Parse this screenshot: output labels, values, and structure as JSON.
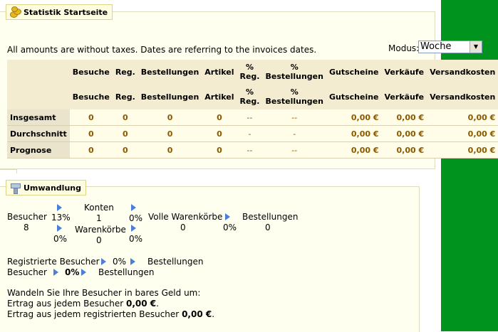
{
  "stats_panel": {
    "title": "Statistik Startseite",
    "icon": "coins-icon",
    "note": "All amounts are without taxes. Dates are referring to the invoices dates.",
    "mode_label": "Modus:",
    "mode_value": "Woche",
    "columns": [
      "Besuche",
      "Reg.",
      "Bestellungen",
      "Artikel",
      "% Reg.",
      "% Bestellungen",
      "Gutscheine",
      "Verkäufe",
      "Versandkosten"
    ],
    "rows": [
      {
        "label": "Insgesamt",
        "values": [
          "0",
          "0",
          "0",
          "0",
          "--",
          "--",
          "0,00 €",
          "0,00 €",
          "0,00 €"
        ]
      },
      {
        "label": "Durchschnitt",
        "values": [
          "0",
          "0",
          "0",
          "0",
          "-",
          "-",
          "0,00 €",
          "0,00 €",
          "0,00 €"
        ]
      },
      {
        "label": "Prognose",
        "values": [
          "0",
          "0",
          "0",
          "0",
          "--",
          "--",
          "0,00 €",
          "0,00 €",
          "0,00 €"
        ]
      }
    ]
  },
  "conversion_panel": {
    "title": "Umwandlung",
    "icon": "funnel-icon",
    "funnel": {
      "visitors_label": "Besucher",
      "visitors_value": "8",
      "pct_to_accounts": "13%",
      "accounts_label": "Konten",
      "accounts_value": "1",
      "pct_accounts_to_carts": "0%",
      "pct_to_carts": "0%",
      "carts_label": "Warenkörbe",
      "carts_value": "0",
      "pct_carts_from_carts": "0%",
      "full_carts_label": "Volle Warenkörbe",
      "full_carts_value": "0",
      "pct_to_orders": "0%",
      "orders_label": "Bestellungen",
      "orders_value": "0"
    },
    "registered_line": {
      "label": "Registrierte Besucher",
      "pct": "0%",
      "target": "Bestellungen"
    },
    "visitors_line": {
      "label": "Besucher",
      "pct": "0%",
      "target": "Bestellungen"
    },
    "money_intro": "Wandeln Sie Ihre Besucher in bares Geld um:",
    "earning_per_visitor_label": "Ertrag aus jedem Besucher",
    "earning_per_visitor_value": "0,00 €",
    "earning_per_registered_label": "Ertrag aus jedem registrierten Besucher",
    "earning_per_registered_value": "0,00 €"
  },
  "colors": {
    "sidebar": "#00941f",
    "panel_bg": "#fffff0",
    "value_text": "#8a5a00",
    "arrow": "#4a7ed8"
  }
}
